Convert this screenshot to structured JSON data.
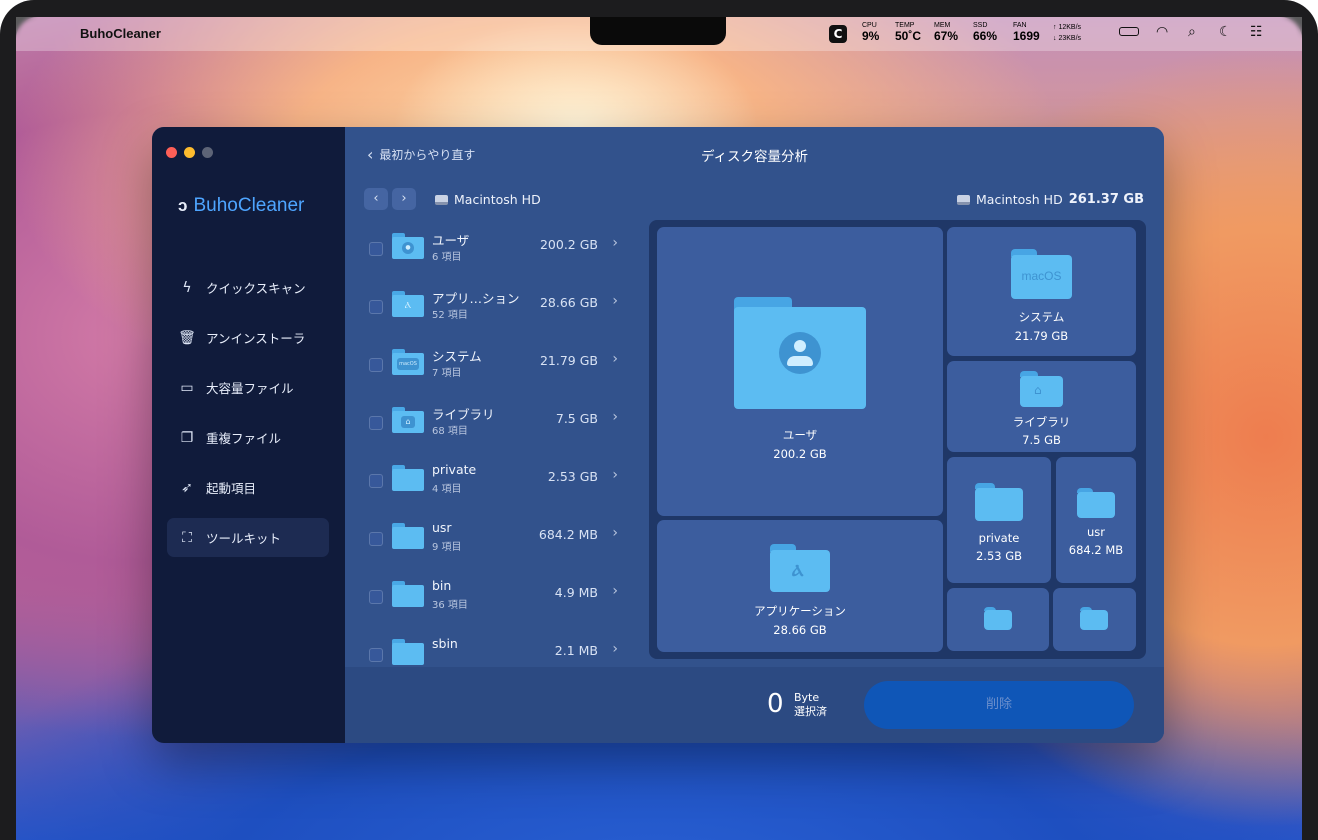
{
  "menubar": {
    "app_name": "BuhoCleaner",
    "stats": [
      {
        "key": "CPU",
        "value": "9%"
      },
      {
        "key": "TEMP",
        "value": "50˚C"
      },
      {
        "key": "MEM",
        "value": "67%"
      },
      {
        "key": "SSD",
        "value": "66%"
      },
      {
        "key": "FAN",
        "value": "1699"
      }
    ],
    "net_up": "↑ 12KB/s",
    "net_down": "↓ 23KB/s"
  },
  "sidebar": {
    "brand": "BuhoCleaner",
    "items": [
      {
        "label": "クイックスキャン",
        "icon": "bolt-icon"
      },
      {
        "label": "アンインストーラ",
        "icon": "trash-icon"
      },
      {
        "label": "大容量ファイル",
        "icon": "folder-icon"
      },
      {
        "label": "重複ファイル",
        "icon": "duplicate-folder-icon"
      },
      {
        "label": "起動項目",
        "icon": "rocket-icon"
      },
      {
        "label": "ツールキット",
        "icon": "toolkit-icon"
      }
    ],
    "active_index": 5
  },
  "header": {
    "back_label": "最初からやり直す",
    "title": "ディスク容量分析"
  },
  "path": {
    "current": "Macintosh HD",
    "disk_name": "Macintosh HD",
    "disk_total": "261.37 GB"
  },
  "list": [
    {
      "name": "ユーザ",
      "count": "6 項目",
      "size": "200.2 GB",
      "badge": "user"
    },
    {
      "name": "アプリ…ション",
      "count": "52 項目",
      "size": "28.66 GB",
      "badge": "app"
    },
    {
      "name": "システム",
      "count": "7 項目",
      "size": "21.79 GB",
      "badge": "macOS"
    },
    {
      "name": "ライブラリ",
      "count": "68 項目",
      "size": "7.5 GB",
      "badge": "library"
    },
    {
      "name": "private",
      "count": "4 項目",
      "size": "2.53 GB",
      "badge": ""
    },
    {
      "name": "usr",
      "count": "9 項目",
      "size": "684.2 MB",
      "badge": ""
    },
    {
      "name": "bin",
      "count": "36 項目",
      "size": "4.9 MB",
      "badge": ""
    },
    {
      "name": "sbin",
      "count": "",
      "size": "2.1 MB",
      "badge": ""
    }
  ],
  "treemap": {
    "users": {
      "name": "ユーザ",
      "size": "200.2 GB"
    },
    "apps": {
      "name": "アプリケーション",
      "size": "28.66 GB"
    },
    "system": {
      "name": "システム",
      "size": "21.79 GB",
      "badge": "macOS"
    },
    "library": {
      "name": "ライブラリ",
      "size": "7.5 GB"
    },
    "private": {
      "name": "private",
      "size": "2.53 GB"
    },
    "usr": {
      "name": "usr",
      "size": "684.2 MB"
    }
  },
  "footer": {
    "selected_value": "0",
    "selected_unit": "Byte",
    "selected_label": "選択済",
    "delete_label": "削除"
  },
  "colors": {
    "sidebar_bg": "#101b3b",
    "main_bg": "#32528c",
    "accent": "#4ea5ff",
    "folder": "#5cbcf2",
    "delete_button": "#0f56b7"
  }
}
